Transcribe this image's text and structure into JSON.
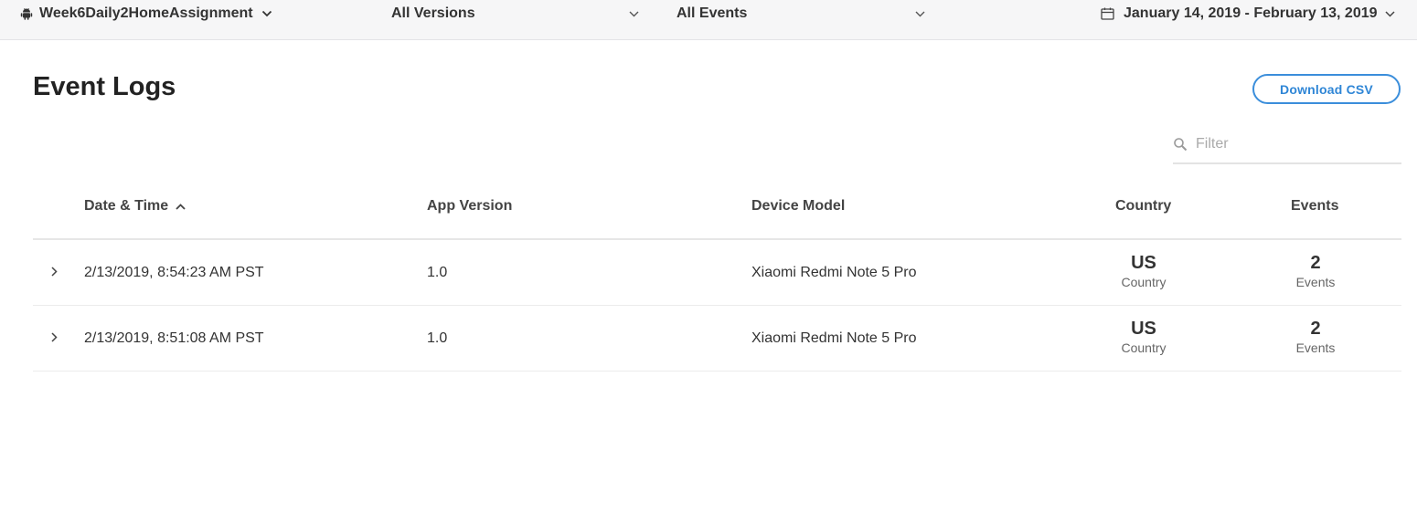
{
  "topbar": {
    "app_name": "Week6Daily2HomeAssignment",
    "version_filter": "All Versions",
    "event_filter": "All Events",
    "date_range": "January 14, 2019 - February 13, 2019"
  },
  "icons": {
    "app": "android-icon",
    "dropdown": "chevron-down-icon",
    "date": "calendar-icon",
    "search": "search-icon",
    "sort": "chevron-up-icon",
    "expand": "chevron-right-icon"
  },
  "page": {
    "title": "Event Logs",
    "download_label": "Download CSV",
    "filter_placeholder": "Filter"
  },
  "colors": {
    "accent": "#3b8edb",
    "topbar_bg": "#f6f6f7"
  },
  "table": {
    "columns": [
      "Date & Time",
      "App Version",
      "Device Model",
      "Country",
      "Events"
    ],
    "sort": "ascending",
    "rows": [
      {
        "datetime": "2/13/2019, 8:54:23 AM PST",
        "version": "1.0",
        "model": "Xiaomi Redmi Note 5 Pro",
        "country": "US",
        "country_label": "Country",
        "events": "2",
        "events_label": "Events"
      },
      {
        "datetime": "2/13/2019, 8:51:08 AM PST",
        "version": "1.0",
        "model": "Xiaomi Redmi Note 5 Pro",
        "country": "US",
        "country_label": "Country",
        "events": "2",
        "events_label": "Events"
      }
    ]
  }
}
